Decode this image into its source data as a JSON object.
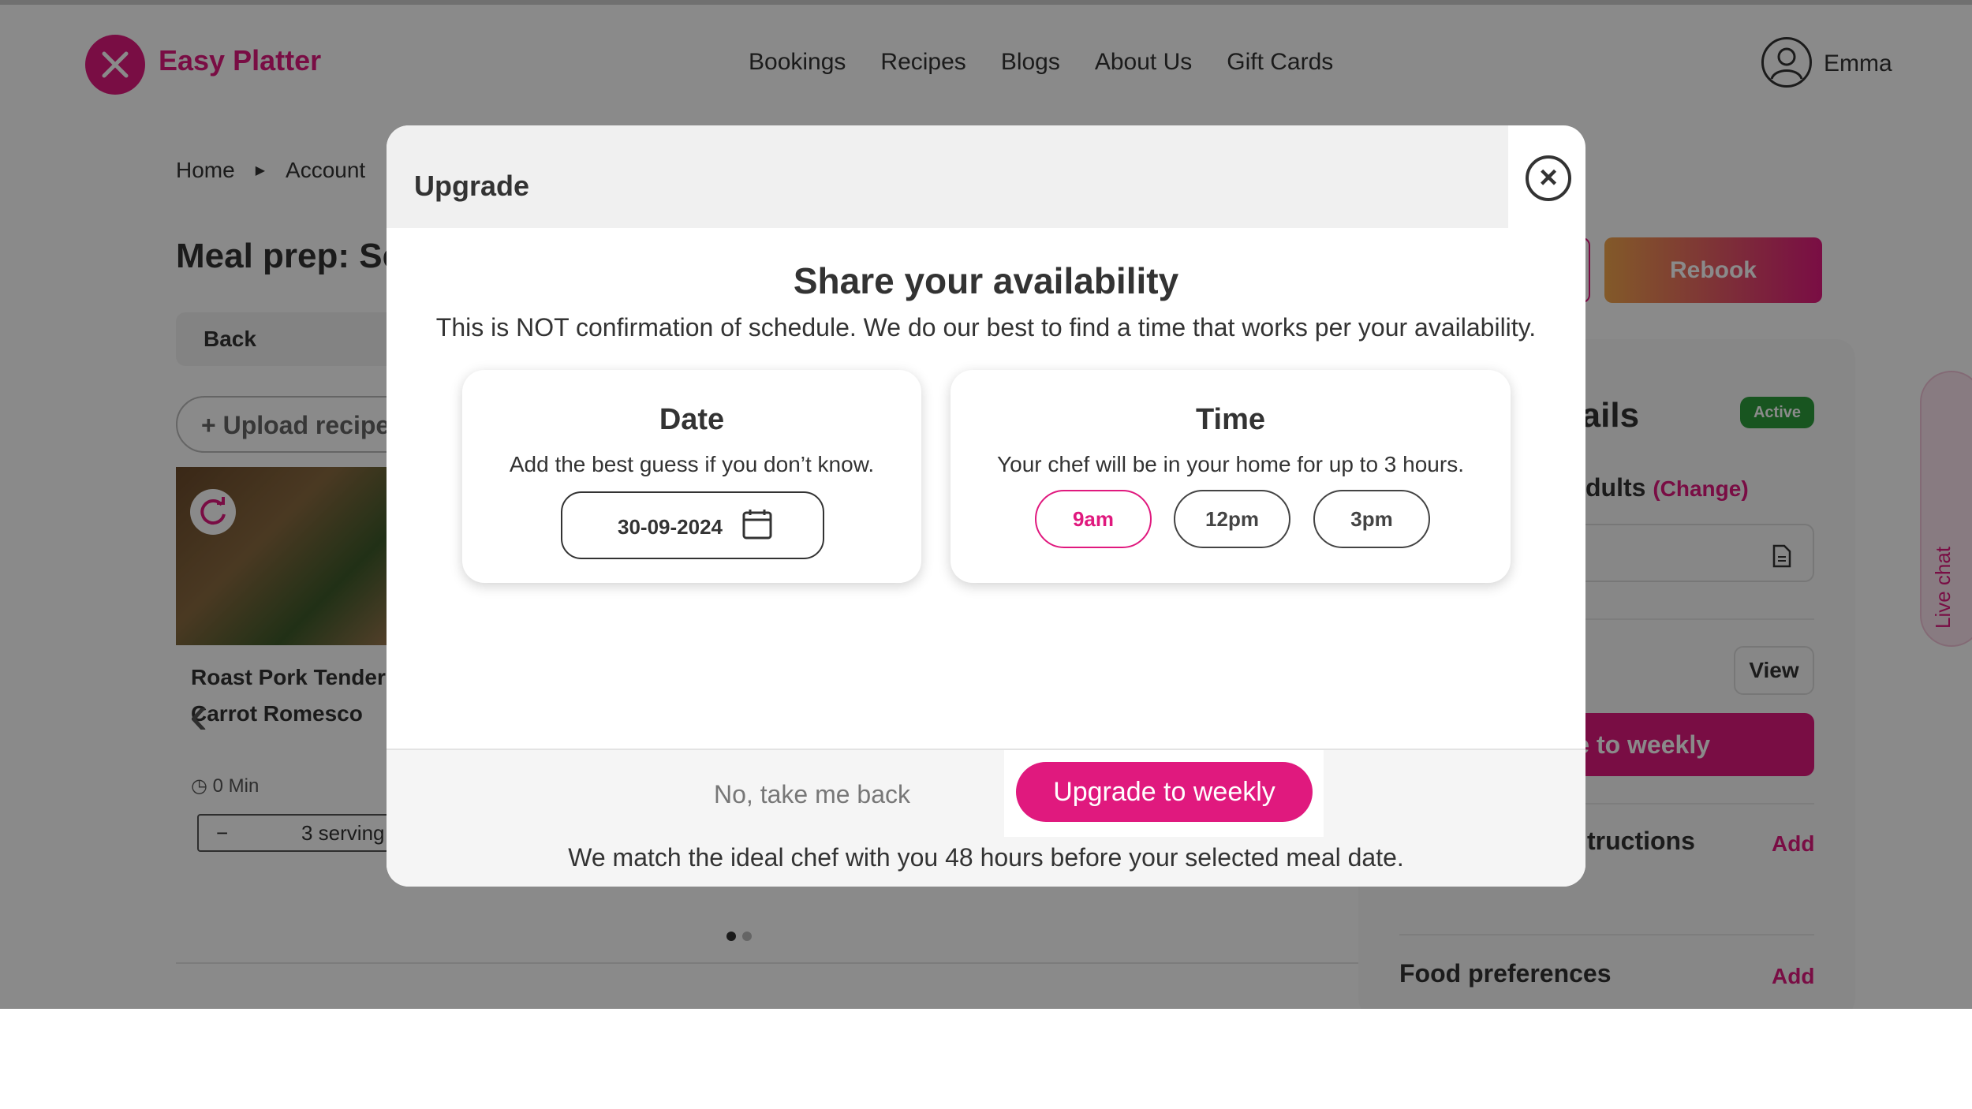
{
  "header": {
    "brand": "Easy Platter",
    "nav": [
      "Bookings",
      "Recipes",
      "Blogs",
      "About Us",
      "Gift Cards"
    ],
    "user_name": "Emma"
  },
  "breadcrumb": [
    "Home",
    "Account"
  ],
  "page": {
    "title": "Meal prep: Se",
    "back_label": "Back",
    "upload_label": "+ Upload recipe",
    "recipe_name": "Roast Pork Tenderl Carrot Romesco",
    "recipe_time": "0 Min",
    "servings_minus": "−",
    "servings_value": "3 serving",
    "rebook_label": "Rebook"
  },
  "side_panel": {
    "title": "tails",
    "status": "Active",
    "adults_label": "dults",
    "change_label": "(Change)",
    "view_label": "View",
    "weekly_label": "e to weekly",
    "instructions_label": "tructions",
    "add_label": "Add",
    "food_prefs_label": "Food preferences",
    "food_add_label": "Add",
    "live_chat_label": "Live chat"
  },
  "modal": {
    "title": "Upgrade",
    "heading": "Share your availability",
    "subheading": "This is NOT confirmation of schedule. We do our best to find a time that works per your availability.",
    "date": {
      "title": "Date",
      "hint": "Add the best guess if you don’t know.",
      "value": "30-09-2024"
    },
    "time": {
      "title": "Time",
      "hint": "Your chef will be in your home for up to 3 hours.",
      "options": [
        "9am",
        "12pm",
        "3pm"
      ],
      "selected": "9am"
    },
    "back_link": "No, take me back",
    "upgrade_button": "Upgrade to weekly",
    "footnote": "We match the ideal chef with you 48 hours before your selected meal date."
  },
  "colors": {
    "brand": "#e0197e",
    "active_badge": "#2e9d3b",
    "overlay": "rgba(0,0,0,0.46)"
  }
}
